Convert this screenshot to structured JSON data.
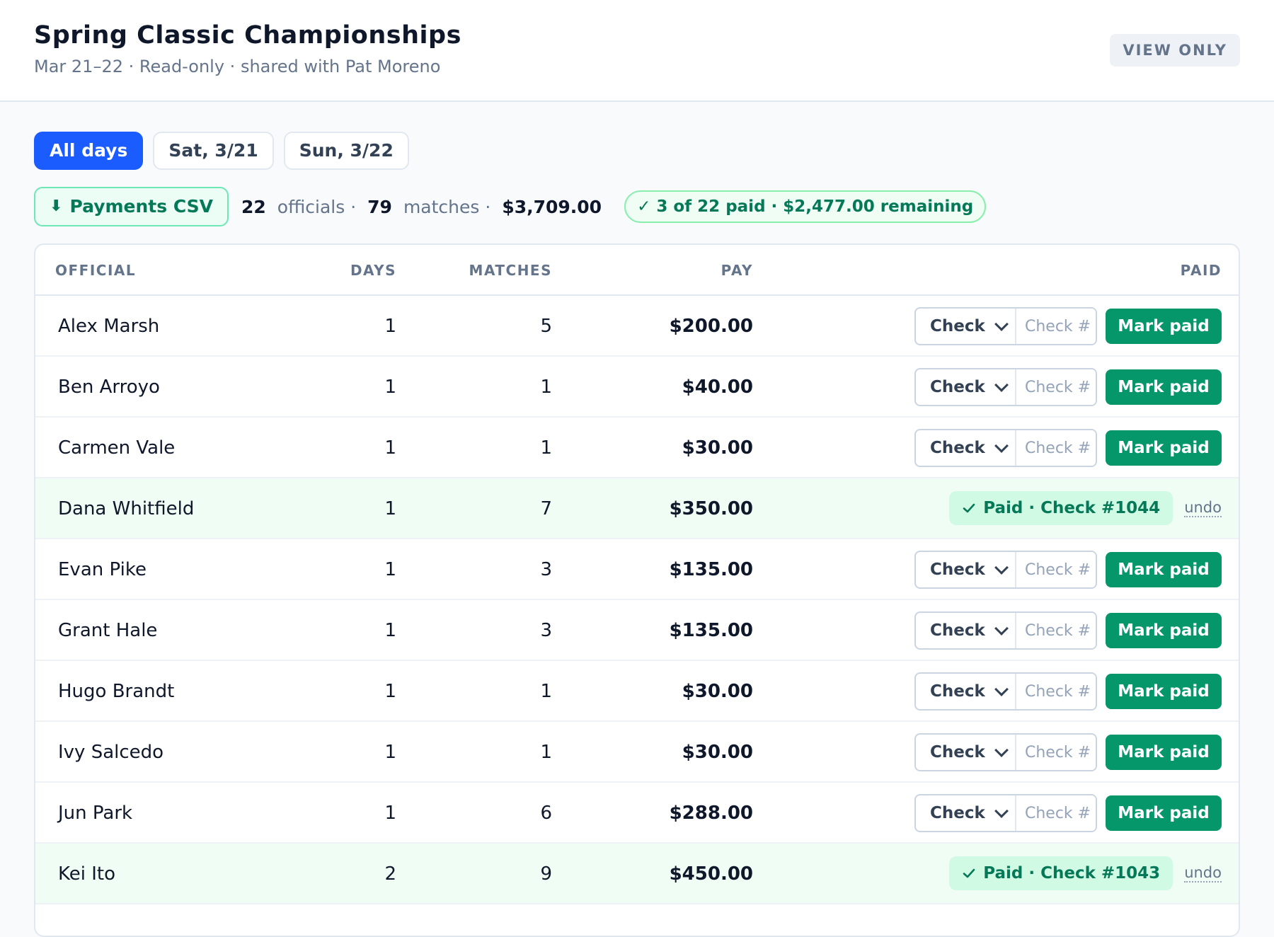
{
  "header": {
    "title": "Spring Classic Championships",
    "subtitle": "Mar 21–22 · Read-only · shared with Pat Moreno",
    "badge": "VIEW ONLY"
  },
  "tabs": [
    {
      "label": "All days",
      "active": true
    },
    {
      "label": "Sat, 3/21",
      "active": false
    },
    {
      "label": "Sun, 3/22",
      "active": false
    }
  ],
  "summary": {
    "csv_icon": "download-arrow-icon",
    "csv_arrow": "⬇",
    "csv_label": "Payments CSV",
    "officials_count": "22",
    "officials_label": "officials ·",
    "matches_count": "79",
    "matches_label": "matches ·",
    "total": "$3,709.00",
    "paid_status": "✓ 3 of 22 paid · $2,477.00 remaining"
  },
  "table": {
    "headers": {
      "official": "OFFICIAL",
      "days": "DAYS",
      "matches": "MATCHES",
      "pay": "PAY",
      "paid": "PAID"
    },
    "method_label": "Check",
    "check_placeholder": "Check #",
    "mark_paid_label": "Mark paid",
    "undo_label": "undo",
    "rows": [
      {
        "name": "Alex Marsh",
        "days": "1",
        "matches": "5",
        "pay": "$200.00",
        "paid": false
      },
      {
        "name": "Ben Arroyo",
        "days": "1",
        "matches": "1",
        "pay": "$40.00",
        "paid": false
      },
      {
        "name": "Carmen Vale",
        "days": "1",
        "matches": "1",
        "pay": "$30.00",
        "paid": false
      },
      {
        "name": "Dana Whitfield",
        "days": "1",
        "matches": "7",
        "pay": "$350.00",
        "paid": true,
        "paid_label": "Paid · Check #1044"
      },
      {
        "name": "Evan Pike",
        "days": "1",
        "matches": "3",
        "pay": "$135.00",
        "paid": false
      },
      {
        "name": "Grant Hale",
        "days": "1",
        "matches": "3",
        "pay": "$135.00",
        "paid": false
      },
      {
        "name": "Hugo Brandt",
        "days": "1",
        "matches": "1",
        "pay": "$30.00",
        "paid": false
      },
      {
        "name": "Ivy Salcedo",
        "days": "1",
        "matches": "1",
        "pay": "$30.00",
        "paid": false
      },
      {
        "name": "Jun Park",
        "days": "1",
        "matches": "6",
        "pay": "$288.00",
        "paid": false
      },
      {
        "name": "Kei Ito",
        "days": "2",
        "matches": "9",
        "pay": "$450.00",
        "paid": true,
        "paid_label": "Paid · Check #1043"
      }
    ]
  },
  "colors": {
    "accent": "#1a5cff",
    "success": "#059669",
    "paid_row_bg": "#f0fdf4"
  }
}
